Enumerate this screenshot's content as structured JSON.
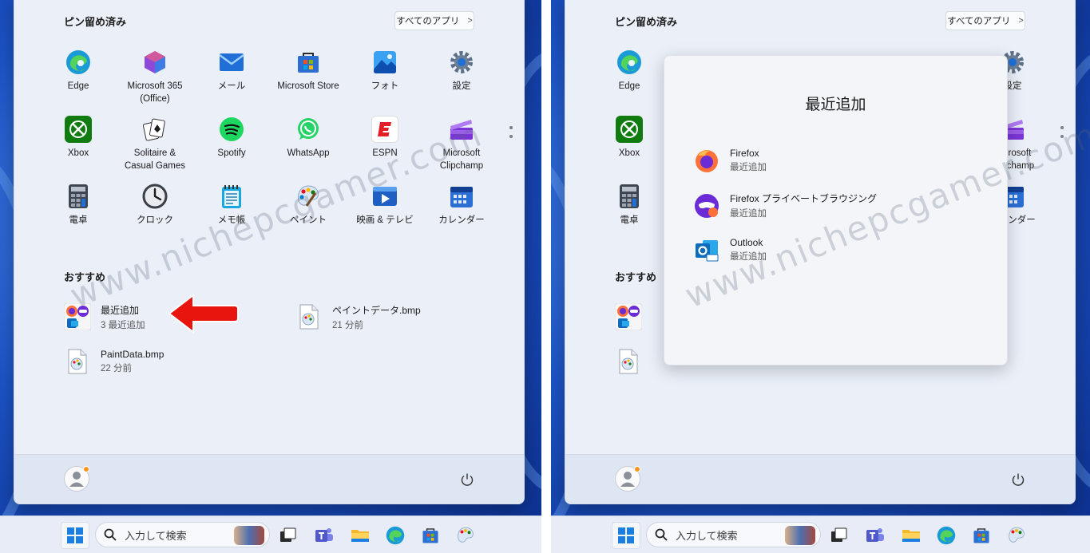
{
  "pinned_title": "ピン留め済み",
  "all_apps_label": "すべてのアプリ",
  "all_apps_chevron": ">",
  "recommended_title": "おすすめ",
  "pinned_apps": [
    {
      "label": "Edge",
      "icon": "edge-icon"
    },
    {
      "label": "Microsoft 365\n(Office)",
      "icon": "microsoft-365-icon"
    },
    {
      "label": "メール",
      "icon": "mail-icon"
    },
    {
      "label": "Microsoft Store",
      "icon": "store-icon"
    },
    {
      "label": "フォト",
      "icon": "photos-icon"
    },
    {
      "label": "設定",
      "icon": "settings-icon"
    },
    {
      "label": "Xbox",
      "icon": "xbox-icon"
    },
    {
      "label": "Solitaire &\nCasual Games",
      "icon": "solitaire-icon"
    },
    {
      "label": "Spotify",
      "icon": "spotify-icon"
    },
    {
      "label": "WhatsApp",
      "icon": "whatsapp-icon"
    },
    {
      "label": "ESPN",
      "icon": "espn-icon"
    },
    {
      "label": "Microsoft\nClipchamp",
      "icon": "clipchamp-icon"
    },
    {
      "label": "電卓",
      "icon": "calculator-icon"
    },
    {
      "label": "クロック",
      "icon": "clock-icon"
    },
    {
      "label": "メモ帳",
      "icon": "notepad-icon"
    },
    {
      "label": "ペイント",
      "icon": "paint-icon"
    },
    {
      "label": "映画 & テレビ",
      "icon": "movies-tv-icon"
    },
    {
      "label": "カレンダー",
      "icon": "calendar-icon"
    }
  ],
  "recommended": [
    {
      "title": "最近追加",
      "subtitle": "3 最近追加",
      "icon": "recently-added-icon"
    },
    {
      "title": "ペイントデータ.bmp",
      "subtitle": "21 分前",
      "icon": "bmp-file-icon"
    },
    {
      "title": "PaintData.bmp",
      "subtitle": "22 分前",
      "icon": "bmp-file-icon"
    }
  ],
  "popup": {
    "title": "最近追加",
    "items": [
      {
        "title": "Firefox",
        "subtitle": "最近追加",
        "icon": "firefox-icon"
      },
      {
        "title": "Firefox プライベートブラウジング",
        "subtitle": "最近追加",
        "icon": "firefox-private-icon"
      },
      {
        "title": "Outlook",
        "subtitle": "最近追加",
        "icon": "outlook-icon"
      }
    ]
  },
  "search_placeholder": "入力して検索",
  "watermark": "www.nichepcgamer.com",
  "colors": {
    "accent": "#0067c0",
    "arrow": "#e8150e",
    "menu_bg": "#eaeff8"
  }
}
